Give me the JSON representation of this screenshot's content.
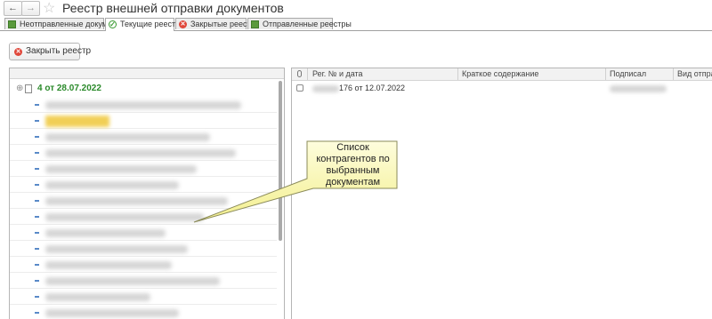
{
  "window": {
    "title": "Реестр внешней отправки документов",
    "nav_back": "←",
    "nav_forward": "→",
    "favorite_icon": "star-icon"
  },
  "tabs": [
    {
      "label": "Неотправленные документы",
      "icon": "green-square-icon",
      "active": false
    },
    {
      "label": "Текущие реестры",
      "icon": "green-check-icon",
      "active": true
    },
    {
      "label": "Закрытые реестры",
      "icon": "red-x-icon",
      "active": false
    },
    {
      "label": "Отправленные реестры",
      "icon": "green-square-icon",
      "active": false
    }
  ],
  "toolbar": {
    "close_registry_label": "Закрыть реестр"
  },
  "tree": {
    "root_label": "4 от 28.07.2022",
    "root_color": "#2b8a2b",
    "item_count": 15,
    "selected_highlight_color": "#f1cd4e"
  },
  "table": {
    "columns": [
      "Рег. № и дата",
      "Краткое содержание",
      "Подписал",
      "Вид отправки"
    ],
    "rows": [
      {
        "reg": "176 от 12.07.2022",
        "summary": "",
        "signed_by": "",
        "delivery": ""
      }
    ]
  },
  "callout": {
    "text": "Список контрагентов по выбранным документам",
    "fill": "#fcfab8",
    "border": "#8b8b5a"
  }
}
